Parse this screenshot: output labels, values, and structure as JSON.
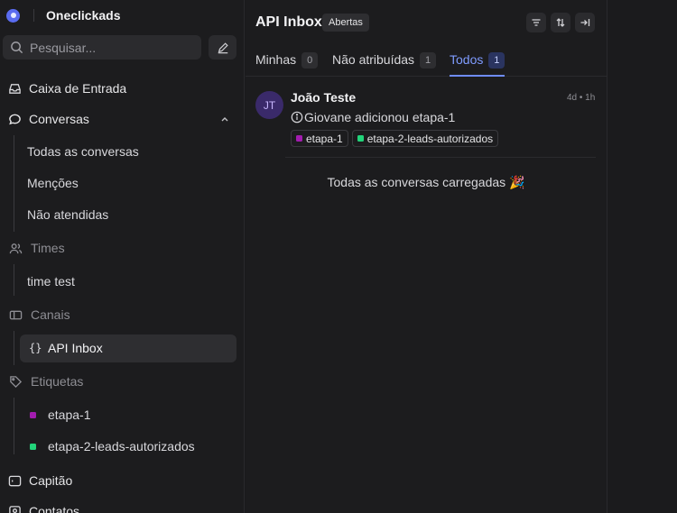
{
  "brand": {
    "name": "Oneclickads"
  },
  "search": {
    "placeholder": "Pesquisar..."
  },
  "nav": {
    "inbox": "Caixa de Entrada",
    "conversations": "Conversas",
    "conversation_items": [
      "Todas as conversas",
      "Menções",
      "Não atendidas"
    ],
    "teams": "Times",
    "team_items": [
      "time test"
    ],
    "channels": "Canais",
    "channel_items": [
      "API Inbox"
    ],
    "labels": "Etiquetas",
    "label_items": [
      {
        "name": "etapa-1",
        "color": "#a21caf"
      },
      {
        "name": "etapa-2-leads-autorizados",
        "color": "#22d37a"
      }
    ],
    "captain": "Capitão",
    "contacts": "Contatos"
  },
  "main": {
    "title": "API Inbox",
    "status": "Abertas",
    "tabs": [
      {
        "label": "Minhas",
        "count": "0"
      },
      {
        "label": "Não atribuídas",
        "count": "1"
      },
      {
        "label": "Todos",
        "count": "1",
        "active": true
      }
    ],
    "conversation": {
      "initials": "JT",
      "name": "João Teste",
      "time": "4d • 1h",
      "message": "Giovane adicionou etapa-1",
      "labels": [
        {
          "name": "etapa-1",
          "color": "#a21caf"
        },
        {
          "name": "etapa-2-leads-autorizados",
          "color": "#22d37a"
        }
      ]
    },
    "end_message": "Todas as conversas carregadas 🎉"
  },
  "colors": {
    "accent": "#6f8cff",
    "background": "#1c1c1e"
  }
}
